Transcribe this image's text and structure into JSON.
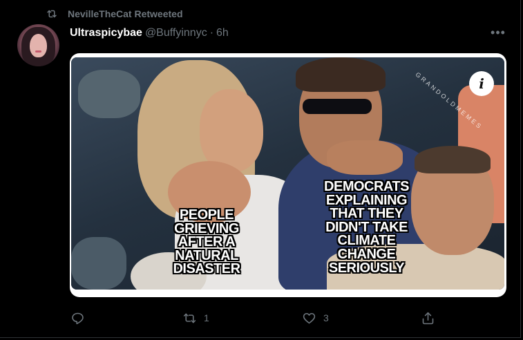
{
  "retweet_context": {
    "icon": "retweet-icon",
    "text": "NevilleTheCat Retweeted"
  },
  "author": {
    "display_name": "Ultraspicybae",
    "handle": "@Buffyinnyc",
    "separator": "·",
    "timestamp": "6h"
  },
  "more_menu": {
    "icon": "more-horizontal-icon",
    "label": "•••"
  },
  "media": {
    "caption_left": "People grieving after a natural disaster",
    "caption_right": "Democrats explaining that they didn't take climate change seriously",
    "watermark": "GRANDOLDMEMES",
    "info_badge": "i"
  },
  "actions": {
    "reply": {
      "icon": "reply-icon",
      "count": ""
    },
    "retweet": {
      "icon": "retweet-icon",
      "count": "1"
    },
    "like": {
      "icon": "heart-icon",
      "count": "3"
    },
    "share": {
      "icon": "share-icon",
      "count": ""
    }
  },
  "colors": {
    "background": "#000000",
    "text_primary": "#ffffff",
    "text_secondary": "#6e767d",
    "divider": "#2f3336"
  }
}
